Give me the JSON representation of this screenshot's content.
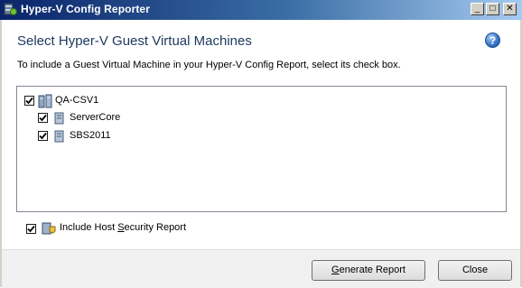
{
  "window": {
    "title": "Hyper-V Config Reporter",
    "controls": {
      "minimize": "_",
      "maximize": "□",
      "close": "✕"
    }
  },
  "header": {
    "title": "Select Hyper-V Guest Virtual Machines",
    "help_glyph": "?",
    "help_icon": "help-icon"
  },
  "instruction": "To include a Guest Virtual Machine in your Hyper-V Config Report, select its check box.",
  "tree": {
    "root": {
      "label": "QA-CSV1",
      "checked": true,
      "icon": "server-cluster-icon"
    },
    "children": [
      {
        "label": "ServerCore",
        "checked": true,
        "icon": "virtual-machine-icon"
      },
      {
        "label": "SBS2011",
        "checked": true,
        "icon": "virtual-machine-icon"
      }
    ]
  },
  "include_host_security": {
    "checked": true,
    "label_prefix": "Include Host ",
    "label_mnemonic": "S",
    "label_suffix": "ecurity Report",
    "icon": "security-shield-icon"
  },
  "buttons": {
    "generate_mnemonic": "G",
    "generate_rest": "enerate Report",
    "close": "Close"
  },
  "colors": {
    "titlebar_start": "#0a246a",
    "titlebar_end": "#a6caf0",
    "header_text": "#1e3a60",
    "footer_bg": "#f0f0f0"
  }
}
